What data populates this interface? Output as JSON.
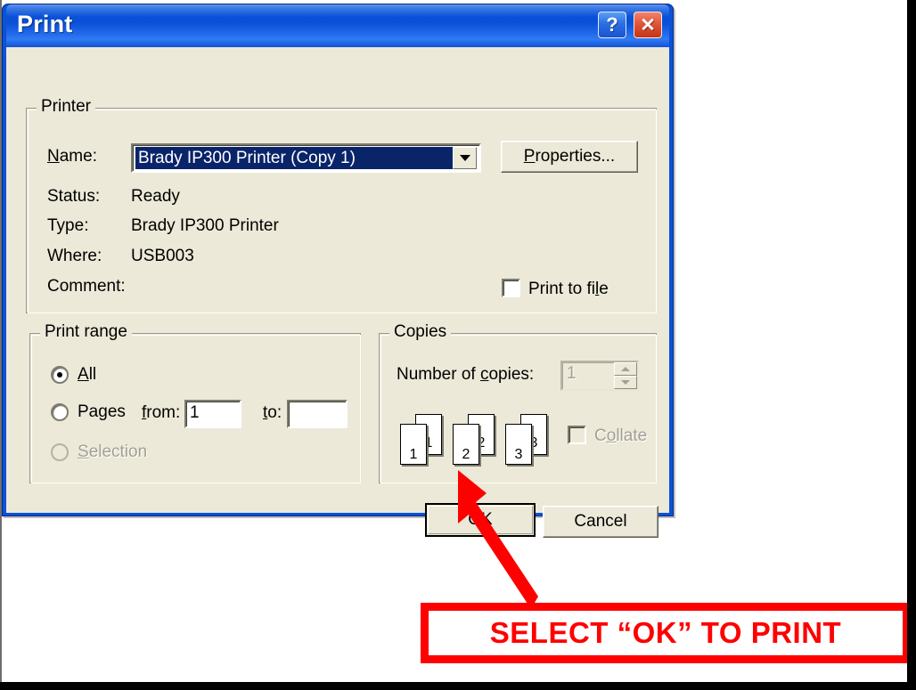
{
  "window": {
    "title": "Print",
    "help_button": "?",
    "close_button": "✕"
  },
  "printer": {
    "group_label": "Printer",
    "name_label": "Name:",
    "name_value": "Brady IP300 Printer (Copy 1)",
    "properties_button": "Properties...",
    "status_label": "Status:",
    "status_value": "Ready",
    "type_label": "Type:",
    "type_value": "Brady IP300 Printer",
    "where_label": "Where:",
    "where_value": "USB003",
    "comment_label": "Comment:",
    "comment_value": "",
    "print_to_file_label": "Print to file",
    "print_to_file_checked": false
  },
  "print_range": {
    "group_label": "Print range",
    "all_label": "All",
    "all_selected": true,
    "pages_label": "Pages",
    "pages_selected": false,
    "from_label": "from:",
    "from_value": "1",
    "to_label": "to:",
    "to_value": "",
    "selection_label": "Selection",
    "selection_enabled": false
  },
  "copies": {
    "group_label": "Copies",
    "number_label": "Number of copies:",
    "number_value": "1",
    "number_enabled": false,
    "collate_label": "Collate",
    "collate_checked": false,
    "collate_enabled": false,
    "sheets": [
      {
        "back": "1",
        "front": "1"
      },
      {
        "back": "2",
        "front": "2"
      },
      {
        "back": "3",
        "front": "3"
      }
    ]
  },
  "actions": {
    "ok_label": "OK",
    "cancel_label": "Cancel"
  },
  "callout": {
    "text": "SELECT “OK” TO PRINT",
    "color": "#FF0000"
  }
}
